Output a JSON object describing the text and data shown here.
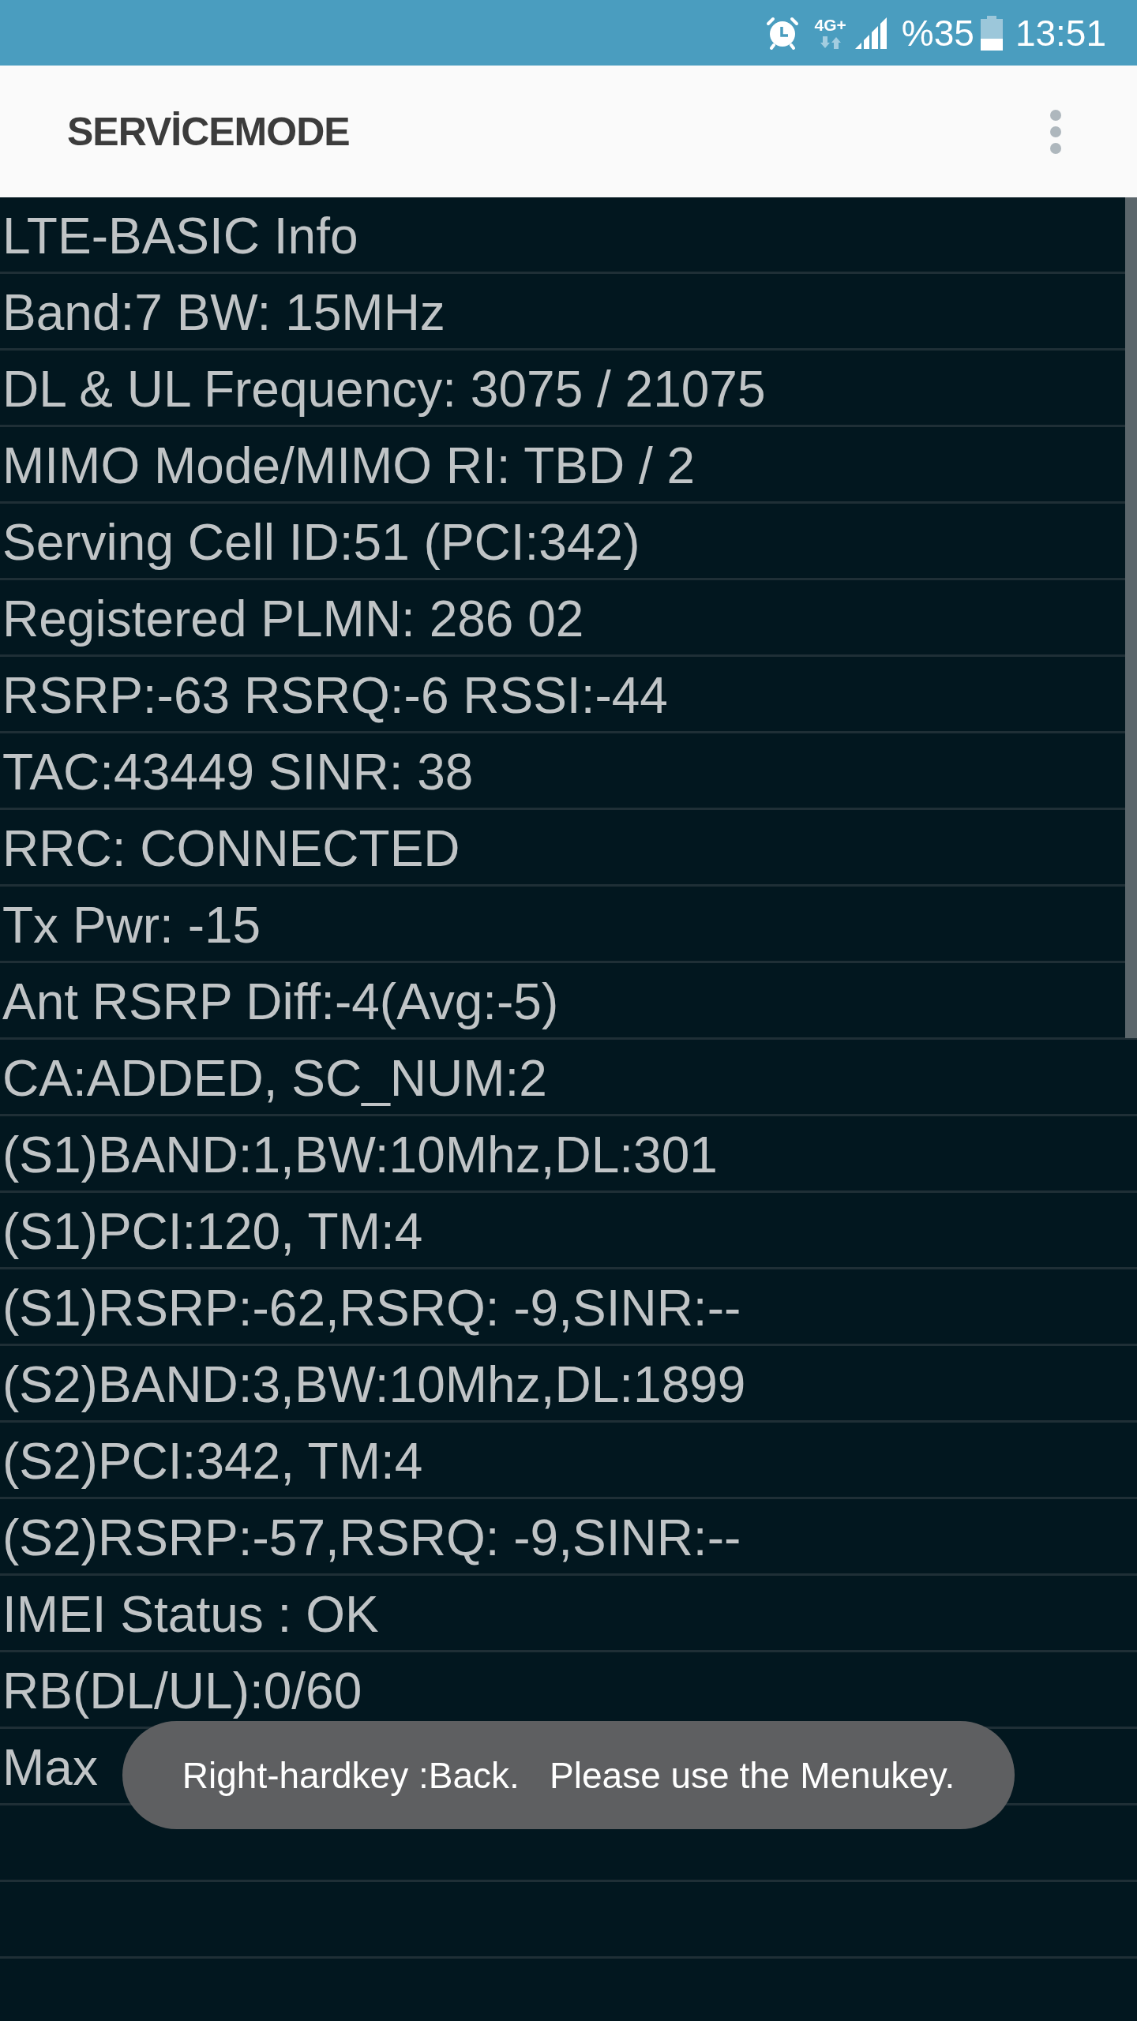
{
  "status_bar": {
    "network_type": "4G+",
    "battery": "%35",
    "time": "13:51"
  },
  "app_bar": {
    "title": "SERVİCEMODE"
  },
  "info_rows": [
    "LTE-BASIC Info",
    "Band:7 BW: 15MHz",
    "DL & UL Frequency: 3075 / 21075",
    "MIMO Mode/MIMO RI: TBD / 2",
    "Serving Cell ID:51 (PCI:342)",
    "Registered PLMN: 286 02",
    "RSRP:-63 RSRQ:-6 RSSI:-44",
    "TAC:43449 SINR: 38",
    "RRC: CONNECTED",
    "Tx Pwr: -15",
    "Ant RSRP Diff:-4(Avg:-5)",
    "CA:ADDED, SC_NUM:2",
    "(S1)BAND:1,BW:10Mhz,DL:301",
    "(S1)PCI:120, TM:4",
    "(S1)RSRP:-62,RSRQ: -9,SINR:--",
    "(S2)BAND:3,BW:10Mhz,DL:1899",
    "(S2)PCI:342, TM:4",
    "(S2)RSRP:-57,RSRQ: -9,SINR:--",
    "IMEI Status : OK",
    "RB(DL/UL):0/60",
    "Max"
  ],
  "toast": {
    "message": "Right-hardkey :Back.   Please use the Menukey."
  }
}
